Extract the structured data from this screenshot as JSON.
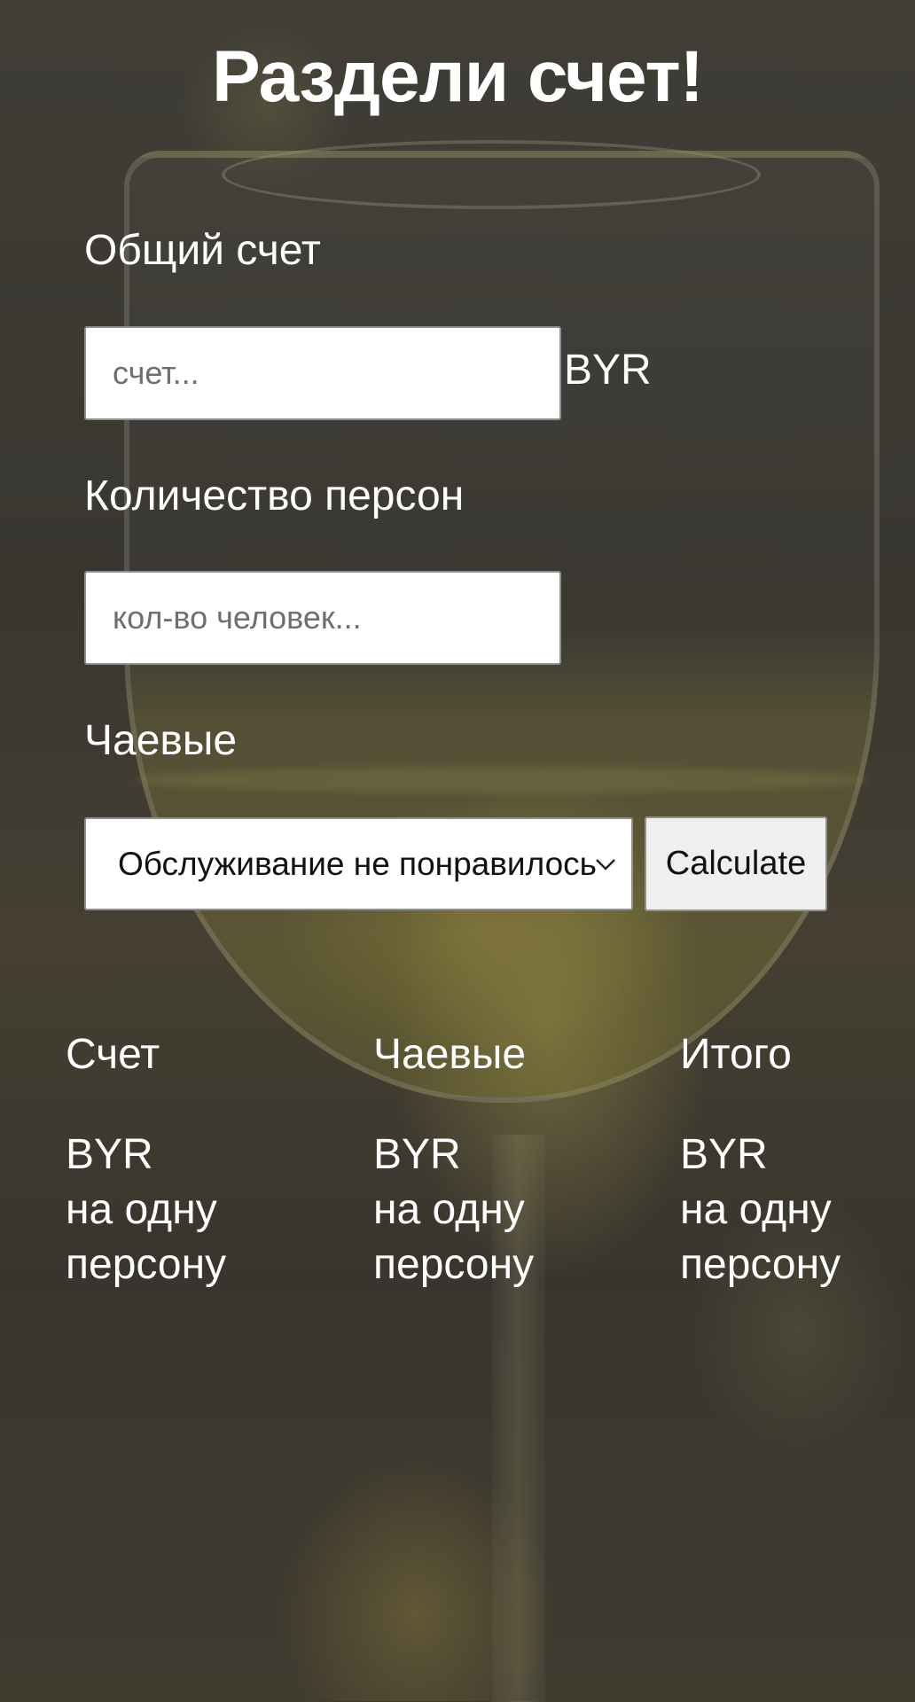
{
  "page": {
    "title": "Раздели счет!"
  },
  "bill": {
    "label": "Общий счет",
    "placeholder": "счет...",
    "value": "",
    "currency": "BYR"
  },
  "people": {
    "label": "Количество персон",
    "placeholder": "кол-во человек...",
    "value": ""
  },
  "tips": {
    "label": "Чаевые",
    "selected": "Обслуживание не понравилось",
    "calculate_label": "Calculate"
  },
  "results": {
    "columns": [
      {
        "heading": "Счет",
        "currency": "BYR",
        "per_line1": "на одну",
        "per_line2": "персону"
      },
      {
        "heading": "Чаевые",
        "currency": "BYR",
        "per_line1": "на одну",
        "per_line2": "персону"
      },
      {
        "heading": "Итого",
        "currency": "BYR",
        "per_line1": "на одну",
        "per_line2": "персону"
      }
    ]
  },
  "icons": {
    "select_arrow": "chevron-down-icon"
  },
  "colors": {
    "text": "#ffffff",
    "input_bg": "#ffffff",
    "button_bg": "#efefef",
    "overlay": "#2d2a26"
  }
}
